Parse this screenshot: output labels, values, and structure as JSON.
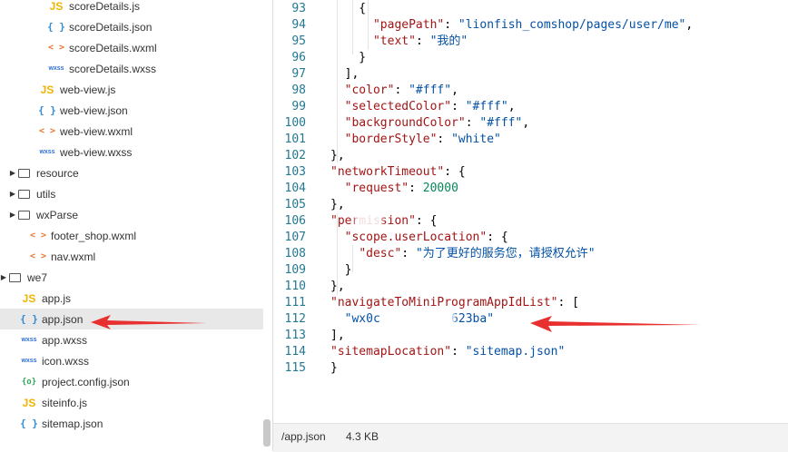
{
  "sidebar": {
    "items": [
      {
        "label": "scoreDetails.js",
        "icon": "js-file-icon",
        "glyph": "JS",
        "kind": "js",
        "indent": 52
      },
      {
        "label": "scoreDetails.json",
        "icon": "json-file-icon",
        "glyph": "{ }",
        "kind": "json",
        "indent": 52
      },
      {
        "label": "scoreDetails.wxml",
        "icon": "wxml-file-icon",
        "glyph": "< >",
        "kind": "wxml",
        "indent": 52
      },
      {
        "label": "scoreDetails.wxss",
        "icon": "wxss-file-icon",
        "glyph": "wxss",
        "kind": "wxss",
        "indent": 52
      },
      {
        "label": "web-view.js",
        "icon": "js-file-icon",
        "glyph": "JS",
        "kind": "js",
        "indent": 42
      },
      {
        "label": "web-view.json",
        "icon": "json-file-icon",
        "glyph": "{ }",
        "kind": "json",
        "indent": 42
      },
      {
        "label": "web-view.wxml",
        "icon": "wxml-file-icon",
        "glyph": "< >",
        "kind": "wxml",
        "indent": 42
      },
      {
        "label": "web-view.wxss",
        "icon": "wxss-file-icon",
        "glyph": "wxss",
        "kind": "wxss",
        "indent": 42
      },
      {
        "label": "resource",
        "icon": "folder-icon",
        "kind": "folder",
        "indent": 20
      },
      {
        "label": "utils",
        "icon": "folder-icon",
        "kind": "folder",
        "indent": 20
      },
      {
        "label": "wxParse",
        "icon": "folder-icon",
        "kind": "folder",
        "indent": 20
      },
      {
        "label": "footer_shop.wxml",
        "icon": "wxml-file-icon",
        "glyph": "< >",
        "kind": "wxml",
        "indent": 32
      },
      {
        "label": "nav.wxml",
        "icon": "wxml-file-icon",
        "glyph": "< >",
        "kind": "wxml",
        "indent": 32
      },
      {
        "label": "we7",
        "icon": "folder-icon",
        "kind": "folder",
        "indent": 10
      },
      {
        "label": "app.js",
        "icon": "js-file-icon",
        "glyph": "JS",
        "kind": "js",
        "indent": 22
      },
      {
        "label": "app.json",
        "icon": "json-file-icon",
        "glyph": "{ }",
        "kind": "json",
        "indent": 22,
        "selected": true
      },
      {
        "label": "app.wxss",
        "icon": "wxss-file-icon",
        "glyph": "wxss",
        "kind": "wxss",
        "indent": 22
      },
      {
        "label": "icon.wxss",
        "icon": "wxss-file-icon",
        "glyph": "wxss",
        "kind": "wxss",
        "indent": 22
      },
      {
        "label": "project.config.json",
        "icon": "config-file-icon",
        "glyph": "{o}",
        "kind": "cfg",
        "indent": 22
      },
      {
        "label": "siteinfo.js",
        "icon": "js-file-icon",
        "glyph": "JS",
        "kind": "js",
        "indent": 22
      },
      {
        "label": "sitemap.json",
        "icon": "json-file-icon",
        "glyph": "{ }",
        "kind": "json",
        "indent": 22
      }
    ]
  },
  "editor": {
    "lines": [
      {
        "n": "93",
        "tokens": [
          [
            "p",
            "    {"
          ]
        ]
      },
      {
        "n": "94",
        "tokens": [
          [
            "p",
            "      "
          ],
          [
            "k",
            "\"pagePath\""
          ],
          [
            "p",
            ": "
          ],
          [
            "s",
            "\"lionfish_comshop/pages/user/me\""
          ],
          [
            "p",
            ","
          ]
        ]
      },
      {
        "n": "95",
        "tokens": [
          [
            "p",
            "      "
          ],
          [
            "k",
            "\"text\""
          ],
          [
            "p",
            ": "
          ],
          [
            "s",
            "\"我的\""
          ]
        ]
      },
      {
        "n": "96",
        "tokens": [
          [
            "p",
            "    }"
          ]
        ]
      },
      {
        "n": "97",
        "tokens": [
          [
            "p",
            "  ],"
          ]
        ]
      },
      {
        "n": "98",
        "tokens": [
          [
            "p",
            "  "
          ],
          [
            "k",
            "\"color\""
          ],
          [
            "p",
            ": "
          ],
          [
            "s",
            "\"#fff\""
          ],
          [
            "p",
            ","
          ]
        ]
      },
      {
        "n": "99",
        "tokens": [
          [
            "p",
            "  "
          ],
          [
            "k",
            "\"selectedColor\""
          ],
          [
            "p",
            ": "
          ],
          [
            "s",
            "\"#fff\""
          ],
          [
            "p",
            ","
          ]
        ]
      },
      {
        "n": "100",
        "tokens": [
          [
            "p",
            "  "
          ],
          [
            "k",
            "\"backgroundColor\""
          ],
          [
            "p",
            ": "
          ],
          [
            "s",
            "\"#fff\""
          ],
          [
            "p",
            ","
          ]
        ]
      },
      {
        "n": "101",
        "tokens": [
          [
            "p",
            "  "
          ],
          [
            "k",
            "\"borderStyle\""
          ],
          [
            "p",
            ": "
          ],
          [
            "s",
            "\"white\""
          ]
        ]
      },
      {
        "n": "102",
        "tokens": [
          [
            "p",
            "},"
          ]
        ]
      },
      {
        "n": "103",
        "tokens": [
          [
            "k",
            "\"networkTimeout\""
          ],
          [
            "p",
            ": {"
          ]
        ]
      },
      {
        "n": "104",
        "tokens": [
          [
            "p",
            "  "
          ],
          [
            "k",
            "\"request\""
          ],
          [
            "p",
            ": "
          ],
          [
            "n",
            "20000"
          ]
        ]
      },
      {
        "n": "105",
        "tokens": [
          [
            "p",
            "},"
          ]
        ]
      },
      {
        "n": "106",
        "tokens": [
          [
            "k",
            "\"permission\""
          ],
          [
            "p",
            ": {"
          ]
        ]
      },
      {
        "n": "107",
        "tokens": [
          [
            "p",
            "  "
          ],
          [
            "k",
            "\"scope.userLocation\""
          ],
          [
            "p",
            ": {"
          ]
        ]
      },
      {
        "n": "108",
        "tokens": [
          [
            "p",
            "    "
          ],
          [
            "k",
            "\"desc\""
          ],
          [
            "p",
            ": "
          ],
          [
            "s",
            "\"为了更好的服务您，请授权允许\""
          ]
        ]
      },
      {
        "n": "109",
        "tokens": [
          [
            "p",
            "  }"
          ]
        ]
      },
      {
        "n": "110",
        "tokens": [
          [
            "p",
            "},"
          ]
        ]
      },
      {
        "n": "111",
        "tokens": [
          [
            "k",
            "\"navigateToMiniProgramAppIdList\""
          ],
          [
            "p",
            ": ["
          ]
        ]
      },
      {
        "n": "112",
        "tokens": [
          [
            "p",
            "  "
          ],
          [
            "s",
            "\"wx0c          623ba\""
          ]
        ]
      },
      {
        "n": "113",
        "tokens": [
          [
            "p",
            "],"
          ]
        ]
      },
      {
        "n": "114",
        "tokens": [
          [
            "k",
            "\"sitemapLocation\""
          ],
          [
            "p",
            ": "
          ],
          [
            "s",
            "\"sitemap.json\""
          ]
        ]
      },
      {
        "n": "115",
        "tokens": [
          [
            "p",
            "}"
          ]
        ]
      }
    ]
  },
  "status": {
    "path": "/app.json",
    "size": "4.3 KB"
  },
  "colors": {
    "annotation_arrow": "#e83030",
    "selected_row": "#e8e8e8",
    "line_number": "#237893"
  }
}
